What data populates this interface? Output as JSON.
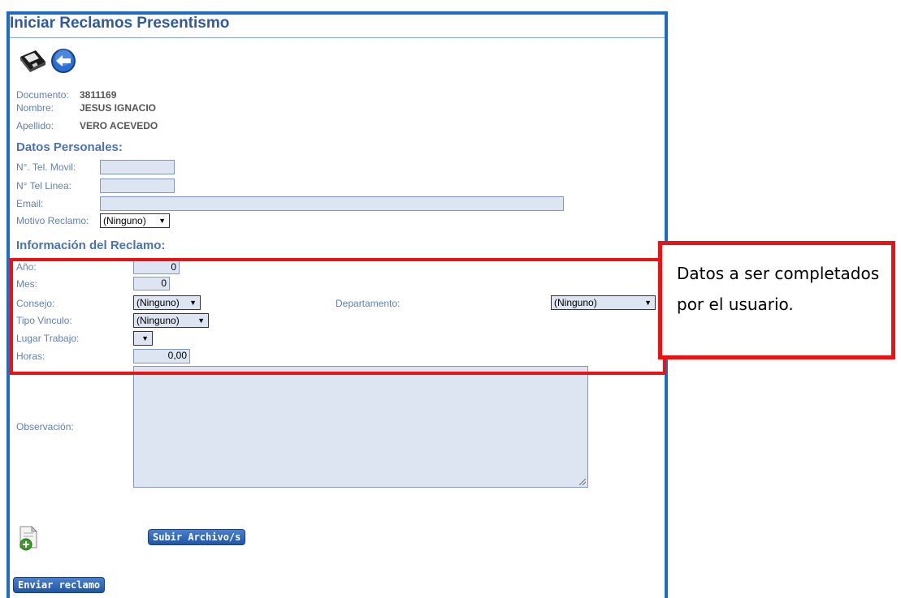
{
  "page": {
    "title": "Iniciar Reclamos Presentismo"
  },
  "toolbar": {
    "save_icon": "save-disk-icon",
    "back_icon": "back-arrow-icon"
  },
  "person": {
    "documento_label": "Documento:",
    "documento_value": "3811169",
    "nombre_label": "Nombre:",
    "nombre_value": "JESUS IGNACIO",
    "apellido_label": "Apellido:",
    "apellido_value": "VERO ACEVEDO"
  },
  "datos_personales": {
    "heading": "Datos Personales:",
    "movil_label": "N°. Tel. Movil:",
    "movil_value": "",
    "linea_label": "N° Tel Linea:",
    "linea_value": "",
    "email_label": "Email:",
    "email_value": "",
    "motivo_label": "Motivo Reclamo:",
    "motivo_value": "(Ninguno)"
  },
  "reclamo": {
    "heading": "Información del Reclamo:",
    "anio_label": "Año:",
    "anio_value": "0",
    "mes_label": "Mes:",
    "mes_value": "0",
    "consejo_label": "Consejo:",
    "consejo_value": "(Ninguno)",
    "departamento_label": "Departamento:",
    "departamento_value": "(Ninguno)",
    "vinculo_label": "Tipo Vinculo:",
    "vinculo_value": "(Ninguno)",
    "lugar_label": "Lugar Trabajo:",
    "lugar_value": "",
    "horas_label": "Horas:",
    "horas_value": "0,00",
    "observacion_label": "Observación:",
    "observacion_value": ""
  },
  "actions": {
    "attach_icon": "add-file-icon",
    "upload_label": "Subir Archivo/s",
    "submit_label": "Enviar reclamo"
  },
  "annotation": {
    "text": "Datos a ser completados por el usuario."
  },
  "colors": {
    "frame": "#1a6fc4",
    "highlight": "#ee1111",
    "field_bg": "#dde4f2",
    "button": "#2a62b6"
  }
}
